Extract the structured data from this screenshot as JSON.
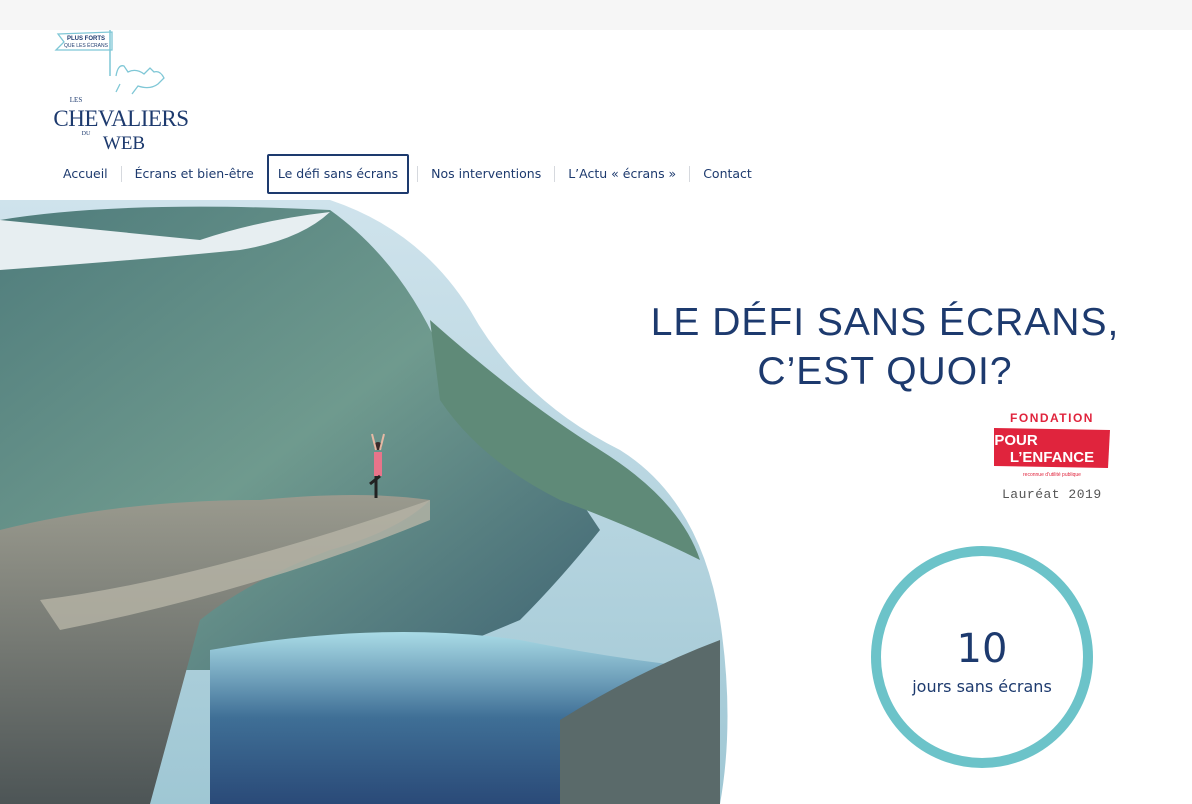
{
  "logo": {
    "flag_text_line1": "PLUS FORTS",
    "flag_text_line2": "QUE LES ÉCRANS",
    "brand_les": "LES",
    "brand_chevaliers": "CHEVALIERS",
    "brand_du": "DU",
    "brand_web": "WEB"
  },
  "nav": {
    "items": [
      {
        "label": "Accueil"
      },
      {
        "label": "Écrans et bien-être"
      },
      {
        "label": "Le défi sans écrans"
      },
      {
        "label": "Nos interventions"
      },
      {
        "label": "L’Actu « écrans »"
      },
      {
        "label": "Contact"
      }
    ],
    "active_index": 2
  },
  "headline": {
    "line1": "LE DÉFI SANS ÉCRANS,",
    "line2": "C’EST QUOI?"
  },
  "fondation": {
    "top": "FONDATION",
    "line1": "POUR",
    "line2": "L’ENFANCE",
    "sub": "reconnue d'utilité publique",
    "award": "Lauréat 2019"
  },
  "counter": {
    "value": "10",
    "label": "jours sans écrans"
  },
  "colors": {
    "navy": "#1d3a6e",
    "teal": "#6cc3c9",
    "fondation_red": "#e0243d",
    "logo_light_blue": "#7fc7d6"
  }
}
